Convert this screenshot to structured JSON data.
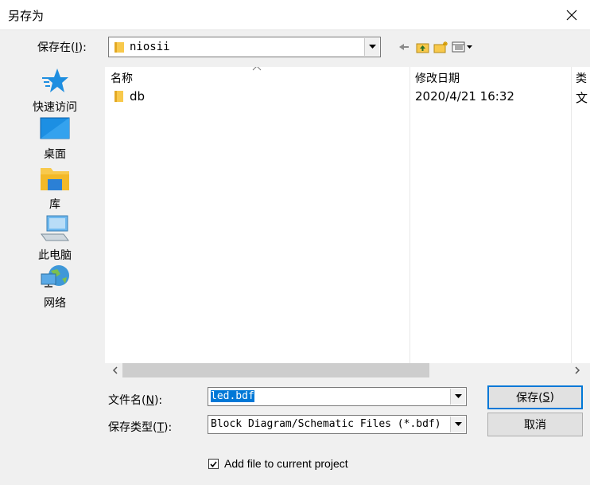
{
  "window": {
    "title": "另存为"
  },
  "look_in": {
    "label_prefix": "保存在(",
    "label_key": "I",
    "label_suffix": "):",
    "value": "niosii"
  },
  "toolbar": {
    "back": "back-icon",
    "up": "up-folder-icon",
    "new_folder": "new-folder-icon",
    "view": "view-menu-icon"
  },
  "places": [
    {
      "label": "快速访问",
      "icon": "quick-access-icon"
    },
    {
      "label": "桌面",
      "icon": "desktop-icon"
    },
    {
      "label": "库",
      "icon": "library-icon"
    },
    {
      "label": "此电脑",
      "icon": "this-pc-icon"
    },
    {
      "label": "网络",
      "icon": "network-icon"
    }
  ],
  "file_list": {
    "columns": [
      "名称",
      "修改日期",
      "类"
    ],
    "rows": [
      {
        "name": "db",
        "date": "2020/4/21 16:32",
        "type": "文"
      }
    ]
  },
  "filename": {
    "label_prefix": "文件名(",
    "label_key": "N",
    "label_suffix": "):",
    "value": "led.bdf"
  },
  "filetype": {
    "label_prefix": "保存类型(",
    "label_key": "T",
    "label_suffix": "):",
    "value": "Block Diagram/Schematic Files (*.bdf)"
  },
  "buttons": {
    "save_prefix": "保存(",
    "save_key": "S",
    "save_suffix": ")",
    "cancel": "取消"
  },
  "add_to_project": {
    "label": "Add file to current project",
    "checked": true
  },
  "colors": {
    "accent": "#0078d7",
    "folder": "#f8c94c"
  }
}
